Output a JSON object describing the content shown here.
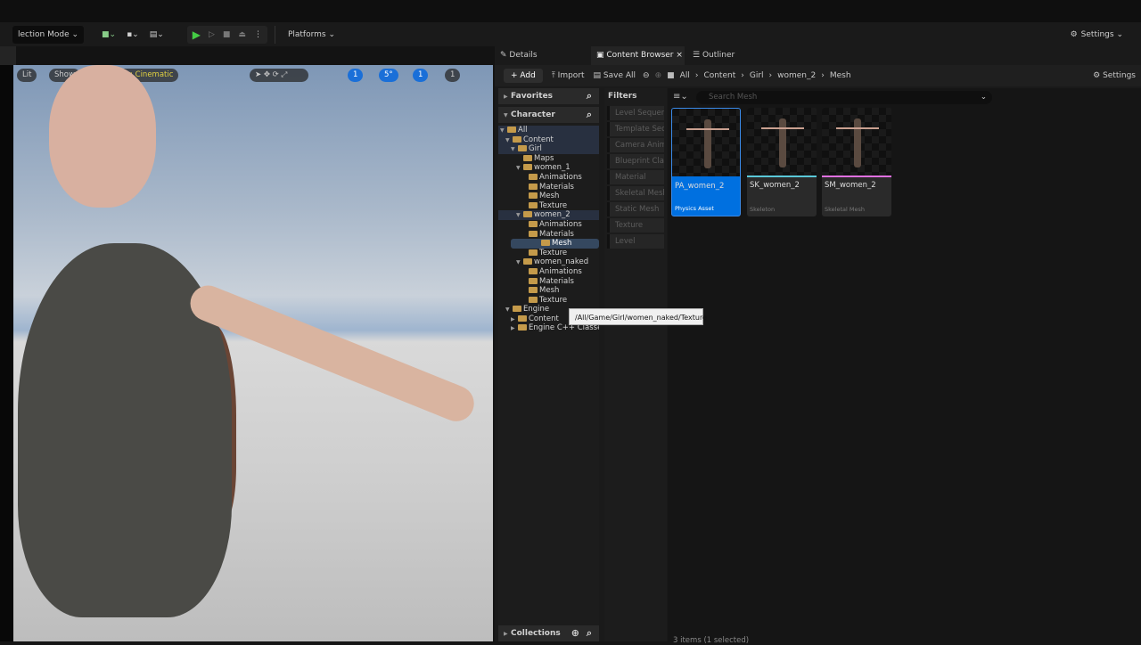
{
  "toolbar": {
    "mode": "lection Mode ⌄",
    "platforms": "Platforms ⌄",
    "settings": "Settings ⌄"
  },
  "viewport": {
    "lit": "Lit",
    "show": "Show",
    "scalability": "Scalability: Cinematic",
    "grid": "1",
    "angle": "5°",
    "scale": "1",
    "camera": "1"
  },
  "tabs": {
    "details": "Details",
    "content_browser": "Content Browser",
    "outliner": "Outliner",
    "close": "×"
  },
  "cb": {
    "add": "+ Add",
    "import": "Import",
    "save_all": "Save All",
    "breadcrumb": [
      "All",
      "Content",
      "Girl",
      "women_2",
      "Mesh"
    ],
    "settings": "Settings",
    "search_placeholder": "Search Mesh",
    "status": "3 items (1 selected)"
  },
  "tree": {
    "favorites": "Favorites",
    "character": "Character",
    "collections": "Collections",
    "items": [
      "All",
      "Content",
      "Girl",
      "Maps",
      "women_1",
      "Animations",
      "Materials",
      "Mesh",
      "Texture",
      "women_2",
      "Animations",
      "Materials",
      "Mesh",
      "Texture",
      "women_naked",
      "Animations",
      "Materials",
      "Mesh",
      "Texture",
      "Engine",
      "Content",
      "Engine C++ Classes"
    ]
  },
  "filters": {
    "title": "Filters",
    "items": [
      "Level Sequence",
      "Template Sequence",
      "Camera Animation",
      "Blueprint Class",
      "Material",
      "Skeletal Mesh",
      "Static Mesh",
      "Texture",
      "Level"
    ]
  },
  "assets": [
    {
      "name": "PA_women_2",
      "type": "Physics Asset",
      "color": "#0070e0"
    },
    {
      "name": "SK_women_2",
      "type": "Skeleton",
      "color": "#5ac8d8"
    },
    {
      "name": "SM_women_2",
      "type": "Skeletal Mesh",
      "color": "#e070e0"
    }
  ],
  "tooltip": "/All/Game/Girl/women_naked/Texture"
}
